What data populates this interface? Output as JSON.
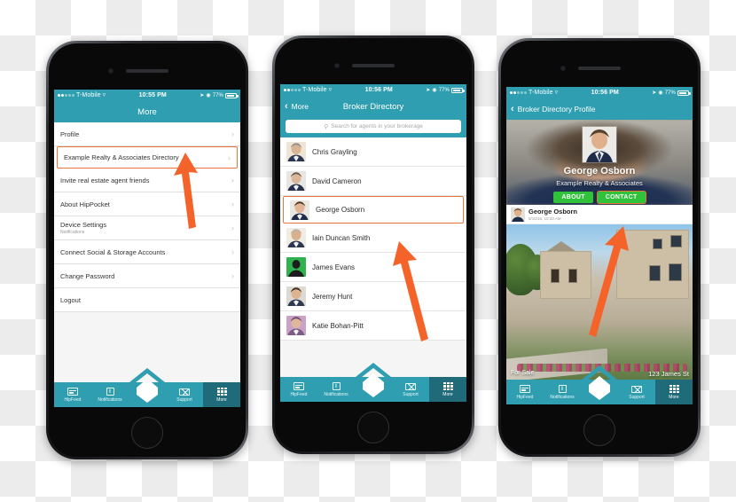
{
  "status_bar": {
    "carrier": "T-Mobile",
    "time_1": "10:55 PM",
    "time_2": "10:56 PM",
    "time_3": "10:56 PM",
    "battery": "77%",
    "wifi_icon": "wifi-icon",
    "location_icon": "location-arrow-icon",
    "alarm_icon": "alarm-icon"
  },
  "tabbar": {
    "items": [
      {
        "label": "HipFeed",
        "icon": "feed-icon",
        "active": false
      },
      {
        "label": "Notifications",
        "icon": "bell-icon",
        "active": false
      },
      {
        "label": "Support",
        "icon": "mail-icon",
        "active": false
      },
      {
        "label": "More",
        "icon": "grid-icon",
        "active": true
      }
    ],
    "center_logo": "house-shield-logo"
  },
  "phone1": {
    "nav_title": "More",
    "menu_items": [
      {
        "label": "Profile",
        "sub": "",
        "highlight": false
      },
      {
        "label": "Example Realty & Associates Directory",
        "sub": "",
        "highlight": true
      },
      {
        "label": "Invite real estate agent friends",
        "sub": "",
        "highlight": false
      },
      {
        "label": "About HipPocket",
        "sub": "",
        "highlight": false
      },
      {
        "label": "Device Settings",
        "sub": "Notifications",
        "highlight": false
      },
      {
        "label": "Connect Social & Storage Accounts",
        "sub": "",
        "highlight": false
      },
      {
        "label": "Change Password",
        "sub": "",
        "highlight": false
      },
      {
        "label": "Logout",
        "sub": "",
        "highlight": false
      }
    ]
  },
  "phone2": {
    "back_label": "More",
    "nav_title": "Broker Directory",
    "search_placeholder": "Search for agents in your brokerage",
    "search_icon": "search-icon",
    "contacts": [
      {
        "name": "Chris Grayling",
        "highlight": false,
        "avatar": "photo"
      },
      {
        "name": "David Cameron",
        "highlight": false,
        "avatar": "photo"
      },
      {
        "name": "George Osborn",
        "highlight": true,
        "avatar": "photo"
      },
      {
        "name": "Iain Duncan Smith",
        "highlight": false,
        "avatar": "photo"
      },
      {
        "name": "James Evans",
        "highlight": false,
        "avatar": "placeholder"
      },
      {
        "name": "Jeremy Hunt",
        "highlight": false,
        "avatar": "photo"
      },
      {
        "name": "Katie Bohan-Pitt",
        "highlight": false,
        "avatar": "photo"
      }
    ]
  },
  "phone3": {
    "back_label": "Broker Directory Profile",
    "profile_name": "George Osborn",
    "profile_org": "Example Realty & Associates",
    "about_button": "ABOUT",
    "contact_button": "CONTACT",
    "post": {
      "author": "George Osborn",
      "timestamp": "5/10/16, 10:33 AM",
      "clock_icon": "clock-icon",
      "status": "For Sale",
      "address": "123 James St"
    }
  },
  "colors": {
    "teal": "#2e9eb0",
    "teal_dark": "#1f6b79",
    "green": "#2fc23a",
    "highlight_orange": "#e8763c",
    "arrow_orange": "#f4642a"
  }
}
